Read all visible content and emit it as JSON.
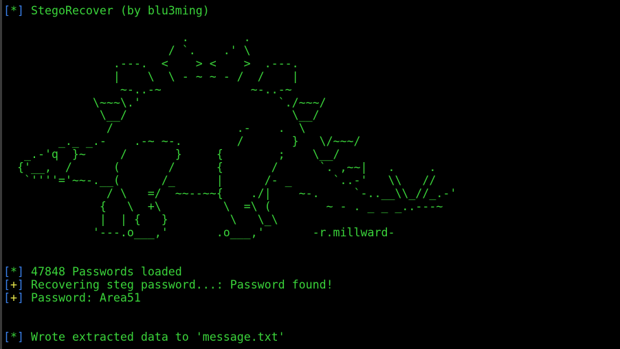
{
  "header": {
    "bracket_open": "[",
    "marker": "*",
    "bracket_close": "]",
    "text": "StegoRecover (by blu3ming)"
  },
  "ascii_art": {
    "lines": [
      "                          .        .",
      "                        / `.    .' \\",
      "                .---.  <    > <    >  .---.",
      "                |    \\  \\ - ~ ~ - /  /    |",
      "                 ~-..-~             ~-..-~",
      "             \\~~~\\.'                    `./~~~/",
      "              \\__/                        \\__/",
      "               /                  .-    .  \\",
      "        _._ _.-    .-~ ~-.        /       }   \\/~~~/",
      "   _.-'q  }~     /       }     {        ;    \\__/",
      "  {'__,  /      (       /      {       /      `. ,~~|   .     .",
      "   `''''='~~-.__(      /_      |      /- _      `..-'   \\\\   //",
      "               / \\   =/  ~~--~~{    ./|    ~-.     `-..__\\\\_//_.-'",
      "              {   \\  +\\         \\  =\\ (        ~ - . _ _ _..---~",
      "              |  | {   }         \\   \\_\\",
      "             '---.o___,'       .o___,'       -r.millward-"
    ]
  },
  "output": [
    {
      "marker": "*",
      "text": "47848 Passwords loaded"
    },
    {
      "marker": "+",
      "text": "Recovering steg password...: Password found!"
    },
    {
      "marker": "+",
      "text": "Password: Area51"
    },
    {
      "marker": "*",
      "text": "Wrote extracted data to 'message.txt'"
    }
  ],
  "colors": {
    "background": "#000000",
    "text": "#3ad33a",
    "bracket": "#3a7fe8",
    "plus_marker": "#e6e64a"
  }
}
